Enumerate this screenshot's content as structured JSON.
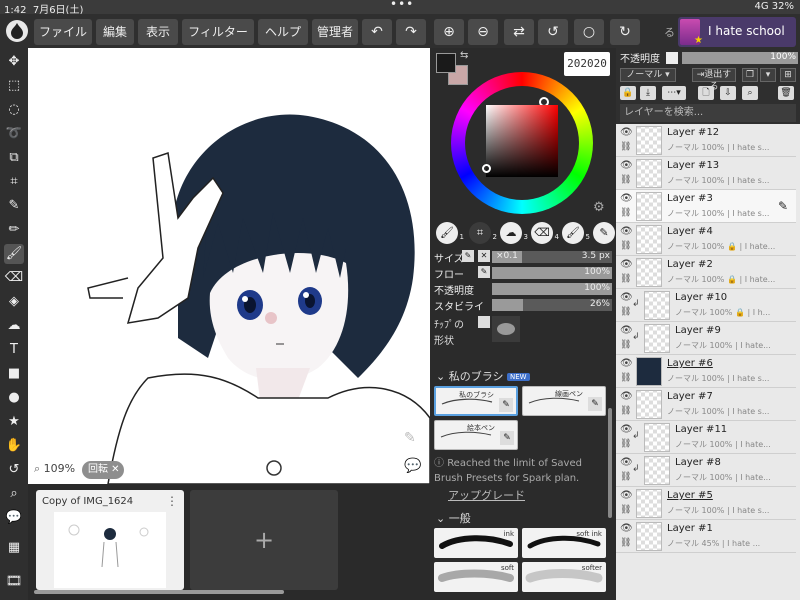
{
  "status": {
    "time": "1:42",
    "date": "7月6日(土)",
    "right": "4G 32%",
    "dots": "•••"
  },
  "menu": {
    "file": "ファイル",
    "edit": "編集",
    "view": "表示",
    "filter": "フィルター",
    "help": "ヘルプ",
    "admin": "管理者"
  },
  "user": {
    "name": "I hate school",
    "tag": "る"
  },
  "canvas": {
    "zoom": "109%",
    "rotate": "回転"
  },
  "documents": {
    "title": "Copy of IMG_1624",
    "add": "+"
  },
  "color": {
    "hex": "202020",
    "fg": "#1a1a1a",
    "bg": "#c9a7a7"
  },
  "brush_tabs": [
    "1",
    "2",
    "3",
    "4",
    "5",
    "6"
  ],
  "params": {
    "size": {
      "label": "サイズ",
      "prefix": "×0.1",
      "value": "3.5 px",
      "fraction": 0.25
    },
    "flow": {
      "label": "フロー",
      "value": "100%",
      "fraction": 1.0
    },
    "opacity": {
      "label": "不透明度",
      "value": "100%",
      "fraction": 1.0
    },
    "stabilizer": {
      "label": "スタビライ",
      "value": "26%",
      "fraction": 0.26
    },
    "tip": {
      "label1": "ﾁｯﾌﾟの",
      "label2": "形状"
    }
  },
  "my_brushes": {
    "header": "私のブラシ",
    "new": "NEW",
    "cards": [
      "私のブラシ",
      "線画ペン",
      "絵本ペン"
    ]
  },
  "notice": {
    "text": "Reached the limit of Saved Brush Presets for Spark plan.",
    "upgrade": "アップグレード"
  },
  "general": {
    "header": "一般",
    "cards": [
      "ink",
      "soft ink",
      "soft",
      "softer"
    ]
  },
  "layer_panel": {
    "opacity_label": "不透明度",
    "opacity_value": "100%",
    "blend": "ノーマル ▾",
    "exit": "⇥退出する",
    "search": "レイヤーを検索..."
  },
  "layers": [
    {
      "name": "Layer #12",
      "sub": "ノーマル 100% | I hate s..."
    },
    {
      "name": "Layer #13",
      "sub": "ノーマル 100% | I hate s..."
    },
    {
      "name": "Layer #3",
      "sub": "ノーマル 100% | I hate s..."
    },
    {
      "name": "Layer #4",
      "sub": "ノーマル 100% 🔒 | I hate..."
    },
    {
      "name": "Layer #2",
      "sub": "ノーマル 100% 🔒 | I hate..."
    },
    {
      "name": "Layer #10",
      "sub": "ノーマル 100% 🔒 | I h..."
    },
    {
      "name": "Layer #9",
      "sub": "ノーマル 100% | I hate..."
    },
    {
      "name": "Layer #6",
      "sub": "ノーマル 100% | I hate s..."
    },
    {
      "name": "Layer #7",
      "sub": "ノーマル 100% | I hate s..."
    },
    {
      "name": "Layer #11",
      "sub": "ノーマル 100% | I hate..."
    },
    {
      "name": "Layer #8",
      "sub": "ノーマル 100% | I hate..."
    },
    {
      "name": "Layer #5",
      "sub": "ノーマル 100% | I hate s..."
    },
    {
      "name": "Layer #1",
      "sub": "ノーマル 45% | I hate ..."
    }
  ]
}
